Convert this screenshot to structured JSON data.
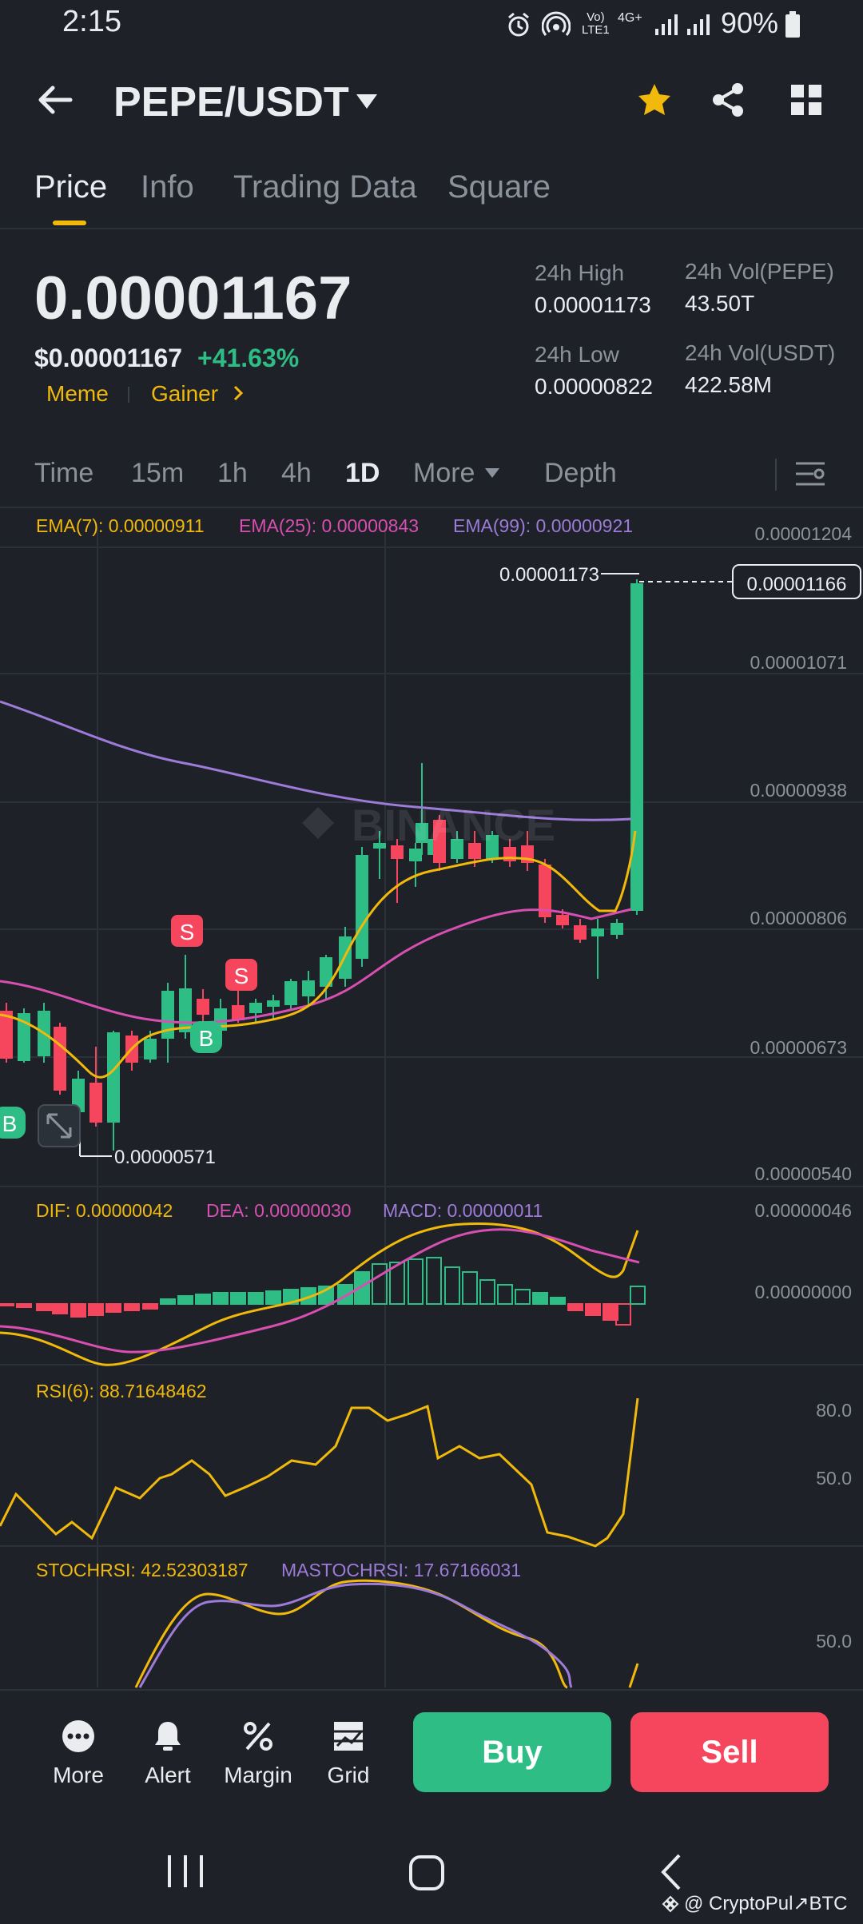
{
  "status_bar": {
    "time": "2:15",
    "network_top": "Vo)",
    "network_bottom": "LTE1",
    "network_type": "4G+",
    "battery": "90%"
  },
  "header": {
    "pair": "PEPE/USDT"
  },
  "tabs": [
    "Price",
    "Info",
    "Trading Data",
    "Square"
  ],
  "price_panel": {
    "last_price": "0.00001167",
    "usd_price": "$0.00001167",
    "change": "+41.63%",
    "tag1": "Meme",
    "tag2": "Gainer",
    "high_label": "24h High",
    "high_value": "0.00001173",
    "low_label": "24h Low",
    "low_value": "0.00000822",
    "vol_pepe_label": "24h Vol(PEPE)",
    "vol_pepe_value": "43.50T",
    "vol_usdt_label": "24h Vol(USDT)",
    "vol_usdt_value": "422.58M"
  },
  "timeframes": [
    "Time",
    "15m",
    "1h",
    "4h",
    "1D",
    "More",
    "Depth"
  ],
  "active_timeframe": "1D",
  "chart": {
    "ema7": "EMA(7): 0.00000911",
    "ema25": "EMA(25): 0.00000843",
    "ema99": "EMA(99): 0.00000921",
    "axis": [
      "0.00001204",
      "0.00001071",
      "0.00000938",
      "0.00000806",
      "0.00000673",
      "0.00000540"
    ],
    "high_marker": "0.00001173",
    "current_price_tag": "0.00001166",
    "low_marker": "0.00000571",
    "watermark": "BINANCE",
    "markers": [
      "S",
      "S",
      "B",
      "B"
    ]
  },
  "macd": {
    "dif": "DIF: 0.00000042",
    "dea": "DEA: 0.00000030",
    "macd": "MACD: 0.00000011",
    "axis_top": "0.00000046",
    "axis_zero": "0.00000000"
  },
  "rsi": {
    "label": "RSI(6): 88.71648462",
    "axis_80": "80.0",
    "axis_50": "50.0"
  },
  "stochrsi": {
    "label": "STOCHRSI: 42.52303187",
    "ma_label": "MASTOCHRSI: 17.67166031",
    "axis_50": "50.0"
  },
  "bottom_bar": {
    "more": "More",
    "alert": "Alert",
    "margin": "Margin",
    "grid": "Grid",
    "buy": "Buy",
    "sell": "Sell"
  },
  "watermark_credit": "@ CryptoPul↗BTC",
  "colors": {
    "up": "#2ebd85",
    "down": "#f6465d",
    "accent": "#f0b90b",
    "ema25": "#d74fb0",
    "ema99": "#9d7bd8"
  }
}
